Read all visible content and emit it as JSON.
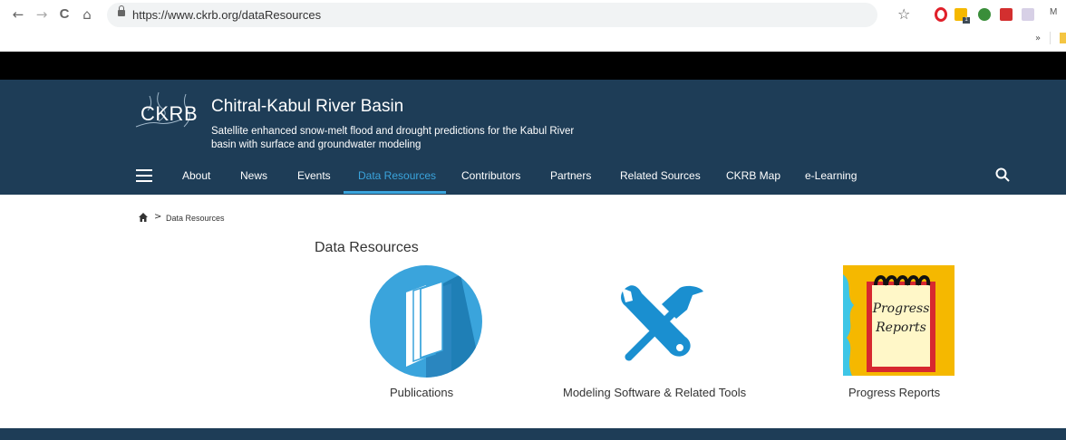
{
  "browser": {
    "url": "https://www.ckrb.org/dataResources",
    "nav": {
      "back": "←",
      "forward": "→",
      "reload": "C",
      "home": "⌂"
    },
    "star_icon": "☆",
    "extensions": [
      "opera-icon",
      "yellow-extension-icon",
      "green-extension-icon",
      "red-extension-icon",
      "document-extension-icon"
    ],
    "extension_badge": "1",
    "profile_initial": "M",
    "more_extensions": "»"
  },
  "site": {
    "logo_text": "CKRB",
    "title": "Chitral-Kabul River Basin",
    "tagline": "Satellite enhanced snow-melt flood and drought predictions for the Kabul River basin with surface and groundwater modeling",
    "header_color": "#1e3d57",
    "accent_color": "#3aa4dc"
  },
  "nav": {
    "items": [
      {
        "label": "About"
      },
      {
        "label": "News"
      },
      {
        "label": "Events"
      },
      {
        "label": "Data Resources",
        "active": true
      },
      {
        "label": "Contributors"
      },
      {
        "label": "Partners"
      },
      {
        "label": "Related Sources"
      },
      {
        "label": "CKRB Map"
      },
      {
        "label": "e-Learning"
      }
    ]
  },
  "breadcrumb": {
    "separator": ">",
    "current": "Data Resources"
  },
  "main": {
    "title": "Data Resources",
    "cards": [
      {
        "label": "Publications",
        "icon": "book-icon"
      },
      {
        "label": "Modeling Software & Related Tools",
        "icon": "wrench-hammer-icon"
      },
      {
        "label": "Progress Reports",
        "icon": "notepad-icon",
        "icon_text": [
          "Progress",
          "Reports"
        ]
      }
    ]
  }
}
